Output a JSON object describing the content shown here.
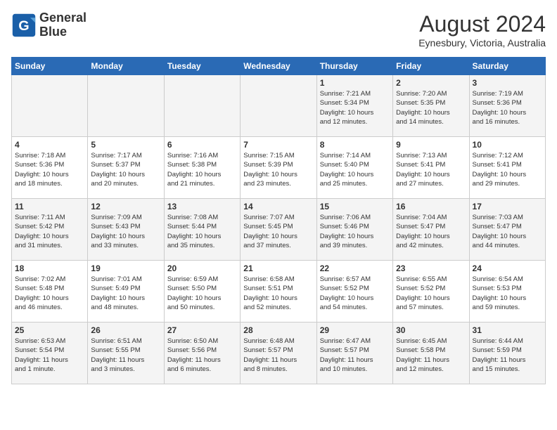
{
  "header": {
    "logo_line1": "General",
    "logo_line2": "Blue",
    "month_year": "August 2024",
    "location": "Eynesbury, Victoria, Australia"
  },
  "weekdays": [
    "Sunday",
    "Monday",
    "Tuesday",
    "Wednesday",
    "Thursday",
    "Friday",
    "Saturday"
  ],
  "weeks": [
    [
      {
        "day": "",
        "info": ""
      },
      {
        "day": "",
        "info": ""
      },
      {
        "day": "",
        "info": ""
      },
      {
        "day": "",
        "info": ""
      },
      {
        "day": "1",
        "info": "Sunrise: 7:21 AM\nSunset: 5:34 PM\nDaylight: 10 hours\nand 12 minutes."
      },
      {
        "day": "2",
        "info": "Sunrise: 7:20 AM\nSunset: 5:35 PM\nDaylight: 10 hours\nand 14 minutes."
      },
      {
        "day": "3",
        "info": "Sunrise: 7:19 AM\nSunset: 5:36 PM\nDaylight: 10 hours\nand 16 minutes."
      }
    ],
    [
      {
        "day": "4",
        "info": "Sunrise: 7:18 AM\nSunset: 5:36 PM\nDaylight: 10 hours\nand 18 minutes."
      },
      {
        "day": "5",
        "info": "Sunrise: 7:17 AM\nSunset: 5:37 PM\nDaylight: 10 hours\nand 20 minutes."
      },
      {
        "day": "6",
        "info": "Sunrise: 7:16 AM\nSunset: 5:38 PM\nDaylight: 10 hours\nand 21 minutes."
      },
      {
        "day": "7",
        "info": "Sunrise: 7:15 AM\nSunset: 5:39 PM\nDaylight: 10 hours\nand 23 minutes."
      },
      {
        "day": "8",
        "info": "Sunrise: 7:14 AM\nSunset: 5:40 PM\nDaylight: 10 hours\nand 25 minutes."
      },
      {
        "day": "9",
        "info": "Sunrise: 7:13 AM\nSunset: 5:41 PM\nDaylight: 10 hours\nand 27 minutes."
      },
      {
        "day": "10",
        "info": "Sunrise: 7:12 AM\nSunset: 5:41 PM\nDaylight: 10 hours\nand 29 minutes."
      }
    ],
    [
      {
        "day": "11",
        "info": "Sunrise: 7:11 AM\nSunset: 5:42 PM\nDaylight: 10 hours\nand 31 minutes."
      },
      {
        "day": "12",
        "info": "Sunrise: 7:09 AM\nSunset: 5:43 PM\nDaylight: 10 hours\nand 33 minutes."
      },
      {
        "day": "13",
        "info": "Sunrise: 7:08 AM\nSunset: 5:44 PM\nDaylight: 10 hours\nand 35 minutes."
      },
      {
        "day": "14",
        "info": "Sunrise: 7:07 AM\nSunset: 5:45 PM\nDaylight: 10 hours\nand 37 minutes."
      },
      {
        "day": "15",
        "info": "Sunrise: 7:06 AM\nSunset: 5:46 PM\nDaylight: 10 hours\nand 39 minutes."
      },
      {
        "day": "16",
        "info": "Sunrise: 7:04 AM\nSunset: 5:47 PM\nDaylight: 10 hours\nand 42 minutes."
      },
      {
        "day": "17",
        "info": "Sunrise: 7:03 AM\nSunset: 5:47 PM\nDaylight: 10 hours\nand 44 minutes."
      }
    ],
    [
      {
        "day": "18",
        "info": "Sunrise: 7:02 AM\nSunset: 5:48 PM\nDaylight: 10 hours\nand 46 minutes."
      },
      {
        "day": "19",
        "info": "Sunrise: 7:01 AM\nSunset: 5:49 PM\nDaylight: 10 hours\nand 48 minutes."
      },
      {
        "day": "20",
        "info": "Sunrise: 6:59 AM\nSunset: 5:50 PM\nDaylight: 10 hours\nand 50 minutes."
      },
      {
        "day": "21",
        "info": "Sunrise: 6:58 AM\nSunset: 5:51 PM\nDaylight: 10 hours\nand 52 minutes."
      },
      {
        "day": "22",
        "info": "Sunrise: 6:57 AM\nSunset: 5:52 PM\nDaylight: 10 hours\nand 54 minutes."
      },
      {
        "day": "23",
        "info": "Sunrise: 6:55 AM\nSunset: 5:52 PM\nDaylight: 10 hours\nand 57 minutes."
      },
      {
        "day": "24",
        "info": "Sunrise: 6:54 AM\nSunset: 5:53 PM\nDaylight: 10 hours\nand 59 minutes."
      }
    ],
    [
      {
        "day": "25",
        "info": "Sunrise: 6:53 AM\nSunset: 5:54 PM\nDaylight: 11 hours\nand 1 minute."
      },
      {
        "day": "26",
        "info": "Sunrise: 6:51 AM\nSunset: 5:55 PM\nDaylight: 11 hours\nand 3 minutes."
      },
      {
        "day": "27",
        "info": "Sunrise: 6:50 AM\nSunset: 5:56 PM\nDaylight: 11 hours\nand 6 minutes."
      },
      {
        "day": "28",
        "info": "Sunrise: 6:48 AM\nSunset: 5:57 PM\nDaylight: 11 hours\nand 8 minutes."
      },
      {
        "day": "29",
        "info": "Sunrise: 6:47 AM\nSunset: 5:57 PM\nDaylight: 11 hours\nand 10 minutes."
      },
      {
        "day": "30",
        "info": "Sunrise: 6:45 AM\nSunset: 5:58 PM\nDaylight: 11 hours\nand 12 minutes."
      },
      {
        "day": "31",
        "info": "Sunrise: 6:44 AM\nSunset: 5:59 PM\nDaylight: 11 hours\nand 15 minutes."
      }
    ]
  ]
}
